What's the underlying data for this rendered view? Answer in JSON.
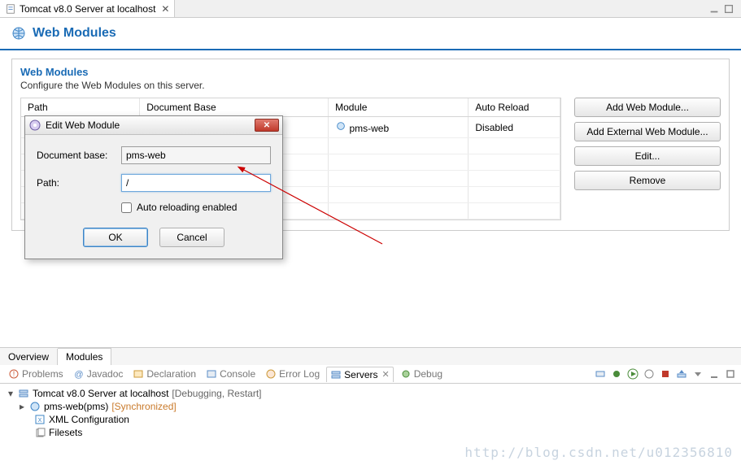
{
  "tab": {
    "title": "Tomcat v8.0 Server at localhost"
  },
  "page": {
    "title": "Web Modules"
  },
  "section": {
    "title": "Web Modules",
    "description": "Configure the Web Modules on this server."
  },
  "table": {
    "headers": {
      "path": "Path",
      "docbase": "Document Base",
      "module": "Module",
      "reload": "Auto Reload"
    },
    "row": {
      "path": "",
      "docbase": "",
      "module": "pms-web",
      "reload": "Disabled"
    }
  },
  "buttons": {
    "add": "Add Web Module...",
    "addExt": "Add External Web Module...",
    "edit": "Edit...",
    "remove": "Remove"
  },
  "bottomTabs": {
    "overview": "Overview",
    "modules": "Modules"
  },
  "views": {
    "problems": "Problems",
    "javadoc": "Javadoc",
    "declaration": "Declaration",
    "console": "Console",
    "errorlog": "Error Log",
    "servers": "Servers",
    "debug": "Debug"
  },
  "servers": {
    "root": "Tomcat v8.0 Server at localhost",
    "rootStatus": "[Debugging, Restart]",
    "child1": "pms-web(pms)",
    "child1Status": "[Synchronized]",
    "child2": "XML Configuration",
    "child3": "Filesets"
  },
  "dialog": {
    "title": "Edit Web Module",
    "docbaseLabel": "Document base:",
    "docbaseValue": "pms-web",
    "pathLabel": "Path:",
    "pathValue": "/",
    "autoLabel": "Auto reloading enabled",
    "ok": "OK",
    "cancel": "Cancel"
  },
  "watermark": "http://blog.csdn.net/u012356810"
}
